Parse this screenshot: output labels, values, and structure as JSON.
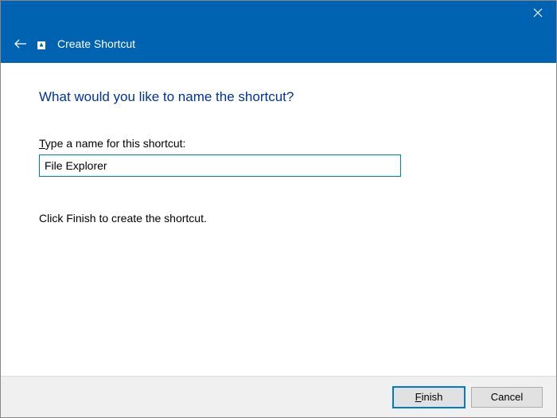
{
  "header": {
    "title": "Create Shortcut"
  },
  "content": {
    "heading": "What would you like to name the shortcut?",
    "label_prefix_underlined": "T",
    "label_rest": "ype a name for this shortcut:",
    "input_value": "File Explorer",
    "hint": "Click Finish to create the shortcut."
  },
  "footer": {
    "finish_underlined": "F",
    "finish_rest": "inish",
    "cancel": "Cancel"
  }
}
